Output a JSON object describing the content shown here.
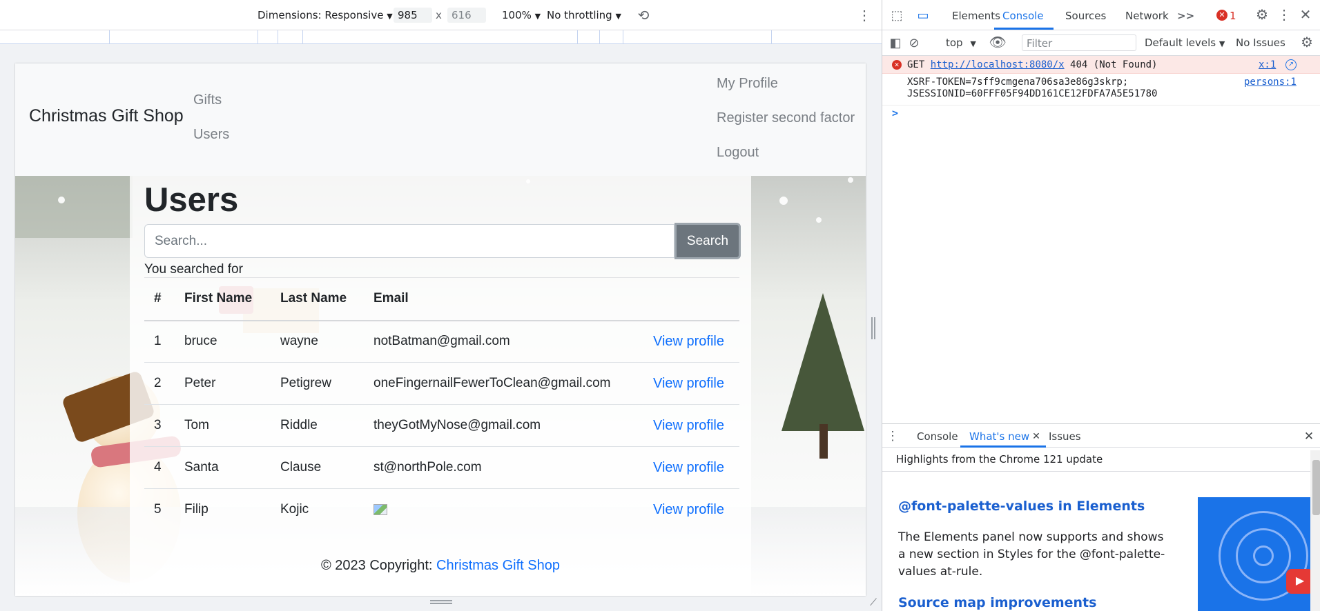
{
  "device_toolbar": {
    "dimensions_label": "Dimensions: Responsive",
    "width": "985",
    "height": "616",
    "times": "x",
    "zoom": "100%",
    "throttling": "No throttling"
  },
  "page": {
    "brand": "Christmas Gift Shop",
    "nav_left": [
      "Gifts",
      "Users"
    ],
    "nav_right": [
      "My Profile",
      "Register second factor",
      "Logout"
    ],
    "heading": "Users",
    "search_placeholder": "Search...",
    "search_button": "Search",
    "searched_text": "You searched for",
    "table": {
      "headers": [
        "#",
        "First Name",
        "Last Name",
        "Email",
        ""
      ],
      "rows": [
        {
          "num": "1",
          "first": "bruce",
          "last": "wayne",
          "email": "notBatman@gmail.com",
          "action": "View profile"
        },
        {
          "num": "2",
          "first": "Peter",
          "last": "Petigrew",
          "email": "oneFingernailFewerToClean@gmail.com",
          "action": "View profile"
        },
        {
          "num": "3",
          "first": "Tom",
          "last": "Riddle",
          "email": "theyGotMyNose@gmail.com",
          "action": "View profile"
        },
        {
          "num": "4",
          "first": "Santa",
          "last": "Clause",
          "email": "st@northPole.com",
          "action": "View profile"
        },
        {
          "num": "5",
          "first": "Filip",
          "last": "Kojic",
          "email": "",
          "action": "View profile"
        }
      ]
    },
    "footer_prefix": "© 2023 Copyright:",
    "footer_link": "Christmas Gift Shop"
  },
  "devtools": {
    "tabs": [
      "Elements",
      "Console",
      "Sources",
      "Network"
    ],
    "active_tab": "Console",
    "more_tabs": ">>",
    "error_count": "1",
    "console_toolbar": {
      "context": "top",
      "filter_placeholder": "Filter",
      "levels": "Default levels",
      "issues": "No Issues"
    },
    "error_entry": {
      "method": "GET",
      "url": "http://localhost:8080/x",
      "status": "404 (Not Found)",
      "source": "x:1"
    },
    "log_entry": {
      "line1": "XSRF-TOKEN=7sff9cmgena706sa3e86g3skrp;",
      "line2": "JSESSIONID=60FFF05F94DD161CE12FDFA7A5E51780",
      "source": "persons:1"
    },
    "prompt": ">",
    "drawer": {
      "tabs": [
        "Console",
        "What's new",
        "Issues"
      ],
      "active_tab": "What's new",
      "highlights": "Highlights from the Chrome 121 update",
      "item1_title": "@font-palette-values in Elements",
      "item1_body": "The Elements panel now supports and shows a new section in Styles for the @font-palette-values at-rule.",
      "item2_title": "Source map improvements"
    }
  },
  "colors": {
    "link": "#0d6efd",
    "search_button": "#6c757d",
    "devtools_accent": "#1a73e8",
    "error_bg": "#fce8e6"
  }
}
